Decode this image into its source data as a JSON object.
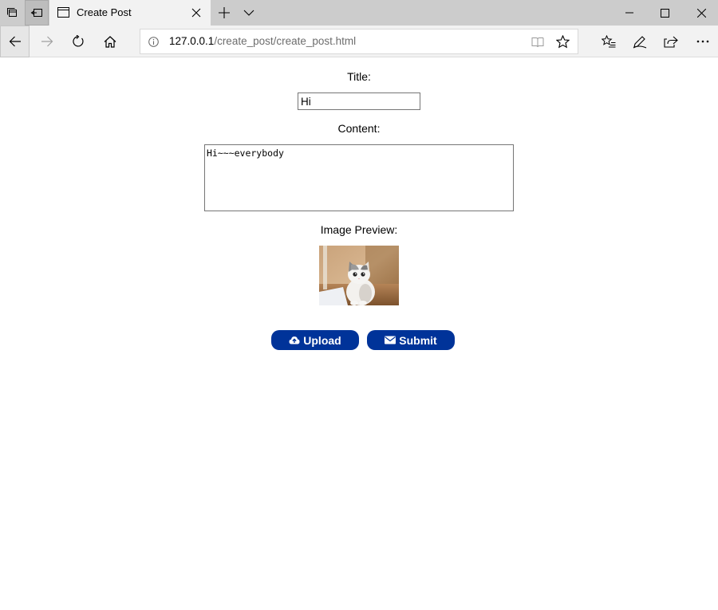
{
  "browser": {
    "tab_title": "Create Post",
    "url_host": "127.0.0.1",
    "url_path": "/create_post/create_post.html"
  },
  "form": {
    "title_label": "Title:",
    "title_value": "Hi",
    "content_label": "Content:",
    "content_value": "Hi~~~everybody",
    "preview_label": "Image Preview:",
    "upload_label": "Upload",
    "submit_label": "Submit"
  },
  "colors": {
    "button_bg": "#003399",
    "tabbar_bg": "#cccccc",
    "toolbar_bg": "#f2f2f2"
  },
  "icons": {
    "upload": "cloud-upload-icon",
    "submit": "envelope-icon"
  }
}
